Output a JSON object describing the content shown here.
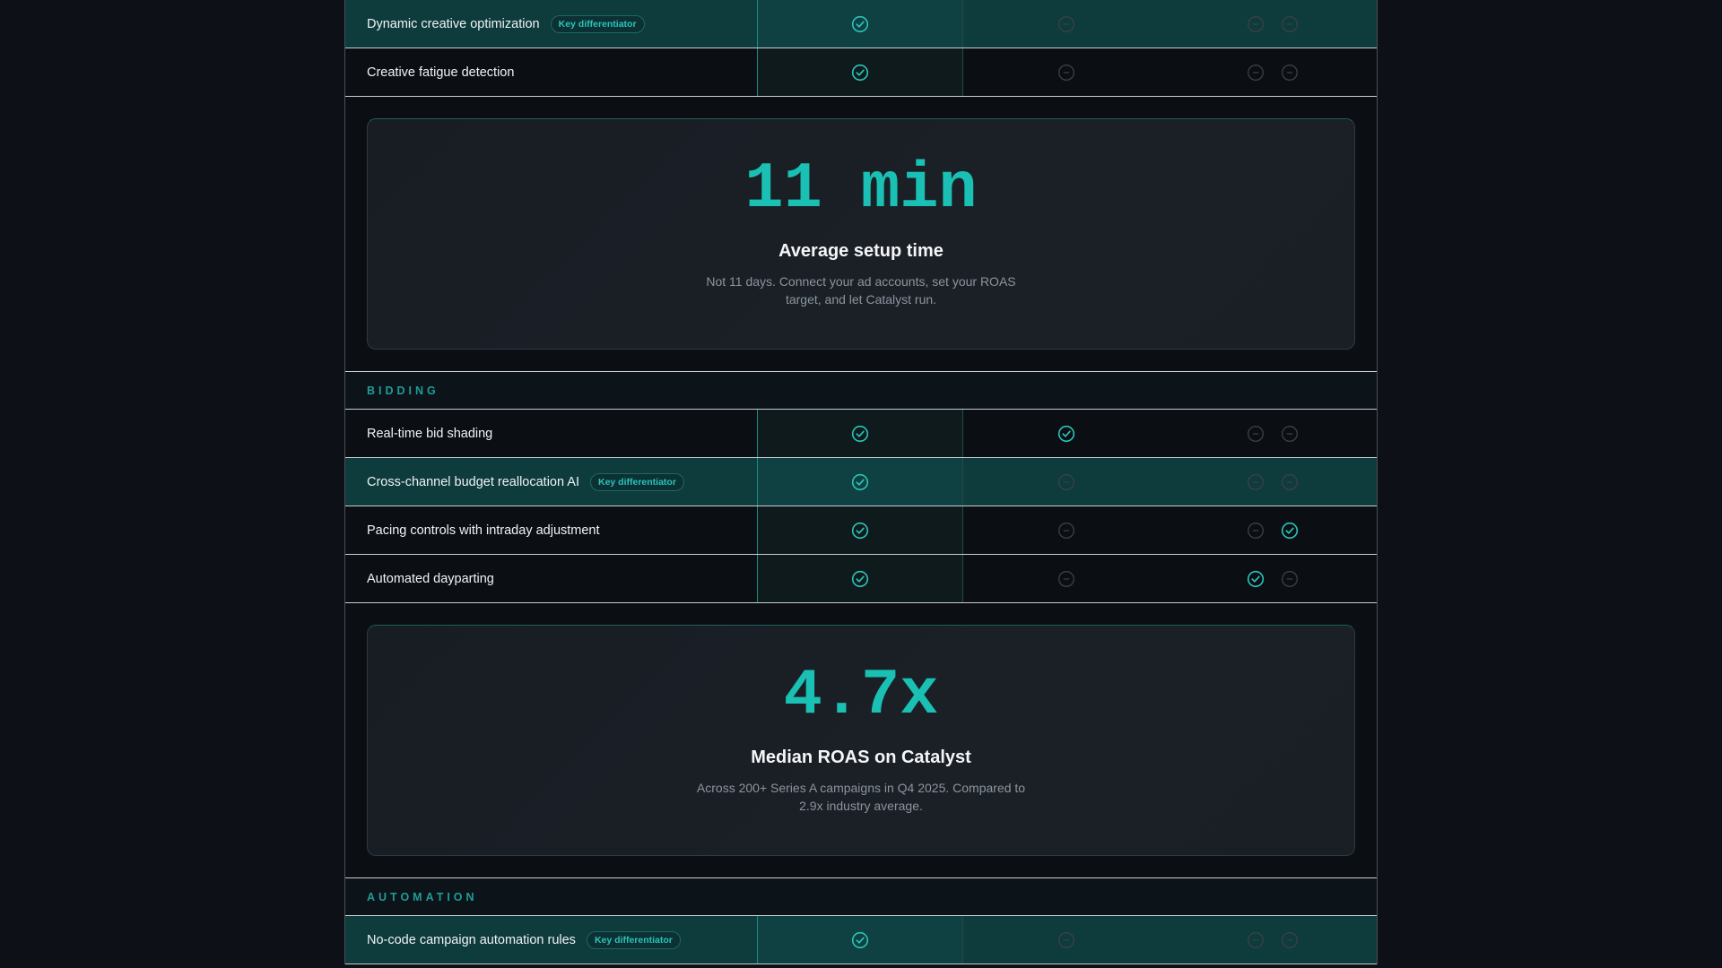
{
  "colors": {
    "accent": "#19c0b3",
    "check": "#2bc4b7",
    "dash": "#3b4148",
    "highlight_row": "#0e3b3c"
  },
  "badge_label": "Key differentiator",
  "rows_top": [
    {
      "label": "Dynamic creative optimization",
      "key": true,
      "highlight": true,
      "c1": "check",
      "c2": "dash",
      "c3": [
        "dash",
        "dash"
      ]
    },
    {
      "label": "Creative fatigue detection",
      "key": false,
      "highlight": false,
      "c1": "check",
      "c2": "dash",
      "c3": [
        "dash",
        "dash"
      ]
    }
  ],
  "stat1": {
    "value": "11 min",
    "label": "Average setup time",
    "description": "Not 11 days. Connect your ad accounts, set your ROAS target, and let Catalyst run."
  },
  "section_bidding": "BIDDING",
  "rows_bidding": [
    {
      "label": "Real-time bid shading",
      "key": false,
      "highlight": false,
      "c1": "check",
      "c2": "check",
      "c3": [
        "dash",
        "dash"
      ]
    },
    {
      "label": "Cross-channel budget reallocation AI",
      "key": true,
      "highlight": true,
      "c1": "check",
      "c2": "dash",
      "c3": [
        "dash",
        "dash"
      ]
    },
    {
      "label": "Pacing controls with intraday adjustment",
      "key": false,
      "highlight": false,
      "c1": "check",
      "c2": "dash",
      "c3": [
        "dash",
        "check"
      ]
    },
    {
      "label": "Automated dayparting",
      "key": false,
      "highlight": false,
      "c1": "check",
      "c2": "dash",
      "c3": [
        "check",
        "dash"
      ]
    }
  ],
  "stat2": {
    "value": "4.7x",
    "label": "Median ROAS on Catalyst",
    "description": "Across 200+ Series A campaigns in Q4 2025. Compared to 2.9x industry average."
  },
  "section_automation": "AUTOMATION",
  "rows_automation": [
    {
      "label": "No-code campaign automation rules",
      "key": true,
      "highlight": true,
      "c1": "check",
      "c2": "dash",
      "c3": [
        "dash",
        "dash"
      ]
    }
  ]
}
